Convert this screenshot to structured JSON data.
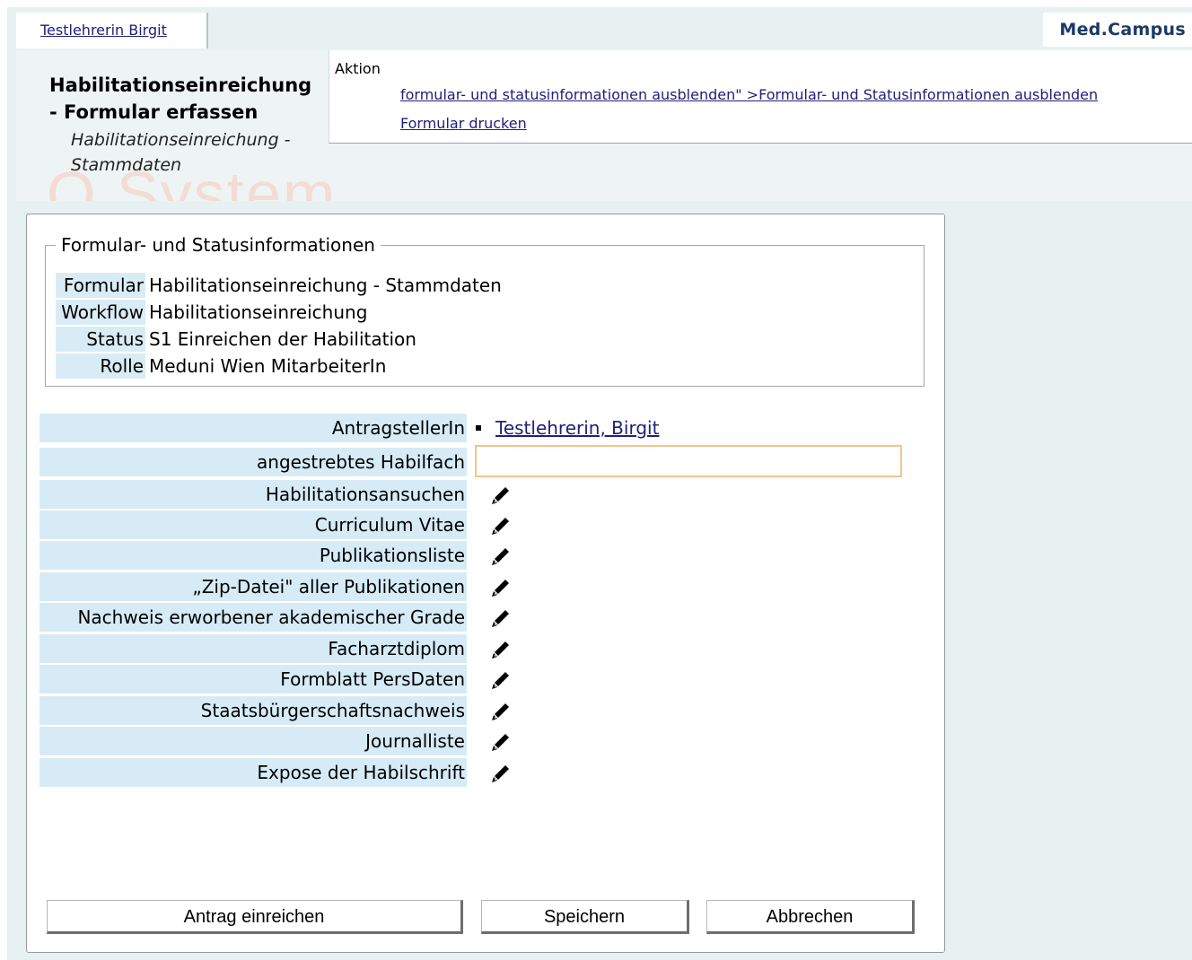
{
  "user_tab": {
    "label": "Testlehrerin Birgit"
  },
  "brand": "Med.Campus",
  "header": {
    "title": "Habilitationseinreichung - Formular erfassen",
    "subtitle": "Habilitationseinreichung - Stammdaten",
    "watermark": "Q System"
  },
  "actions": {
    "label": "Aktion",
    "links": [
      "formular- und statusinformationen ausblenden\" >Formular- und Statusinformationen ausblenden",
      "Formular drucken"
    ]
  },
  "status_info": {
    "legend": "Formular- und Statusinformationen",
    "rows": [
      {
        "label": "Formular",
        "value": "Habilitationseinreichung - Stammdaten"
      },
      {
        "label": "Workflow",
        "value": "Habilitationseinreichung"
      },
      {
        "label": "Status",
        "value": "S1 Einreichen der Habilitation"
      },
      {
        "label": "Rolle",
        "value": "Meduni Wien MitarbeiterIn"
      }
    ]
  },
  "form": {
    "applicant": {
      "label": "AntragstellerIn",
      "value": "Testlehrerin, Birgit"
    },
    "subject": {
      "label": "angestrebtes Habilfach",
      "value": ""
    },
    "documents": [
      "Habilitationsansuchen",
      "Curriculum Vitae",
      "Publikationsliste",
      "„Zip-Datei\" aller Publikationen",
      "Nachweis erworbener akademischer Grade",
      "Facharztdiplom",
      "Formblatt PersDaten",
      "Staatsbürgerschaftsnachweis",
      "Journalliste",
      "Expose der Habilschrift"
    ],
    "document_icon": "pencil-icon"
  },
  "buttons": {
    "submit": "Antrag einreichen",
    "save": "Speichern",
    "cancel": "Abbrechen"
  }
}
